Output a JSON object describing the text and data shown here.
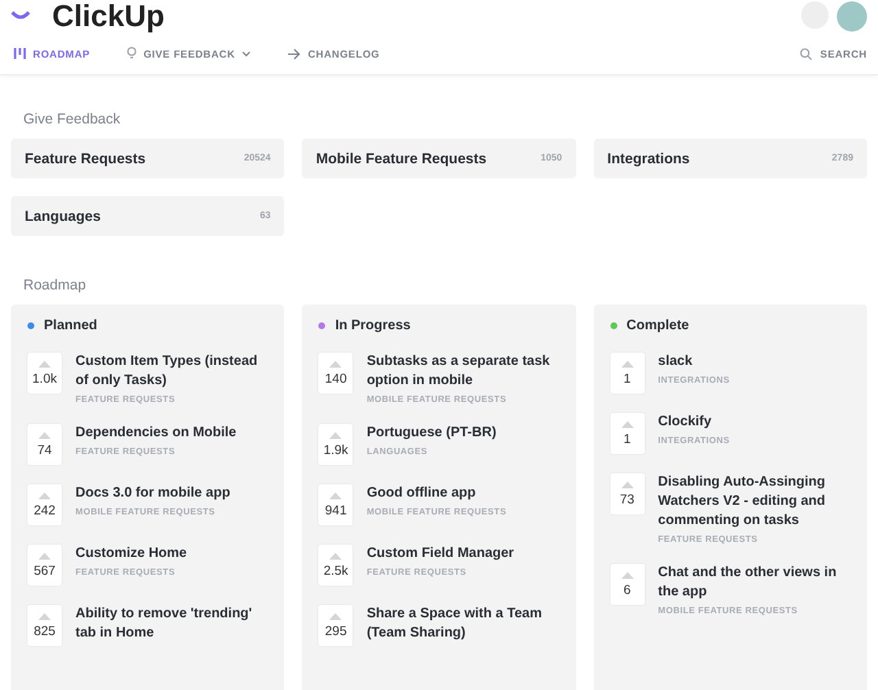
{
  "header": {
    "logo": "ClickUp"
  },
  "nav": [
    {
      "label": "ROADMAP",
      "kind": "roadmap",
      "selected": true
    },
    {
      "label": "GIVE FEEDBACK",
      "kind": "feedback",
      "selected": false,
      "dropdown": true
    },
    {
      "label": "CHANGELOG",
      "kind": "changelog",
      "selected": false
    }
  ],
  "search": {
    "label": "SEARCH"
  },
  "feedback": {
    "title": "Give Feedback",
    "boards": [
      {
        "name": "Feature Requests",
        "count": "20524"
      },
      {
        "name": "Mobile Feature Requests",
        "count": "1050"
      },
      {
        "name": "Integrations",
        "count": "2789"
      },
      {
        "name": "Languages",
        "count": "63"
      }
    ]
  },
  "roadmap": {
    "title": "Roadmap",
    "columns": [
      {
        "name": "Planned",
        "color": "#3b8ee8",
        "items": [
          {
            "votes": "1.0k",
            "title": "Custom Item Types (instead of only Tasks)",
            "category": "FEATURE REQUESTS"
          },
          {
            "votes": "74",
            "title": "Dependencies on Mobile",
            "category": "FEATURE REQUESTS"
          },
          {
            "votes": "242",
            "title": "Docs 3.0 for mobile app",
            "category": "MOBILE FEATURE REQUESTS"
          },
          {
            "votes": "567",
            "title": "Customize Home",
            "category": "FEATURE REQUESTS"
          },
          {
            "votes": "825",
            "title": "Ability to remove 'trending' tab in Home"
          }
        ]
      },
      {
        "name": "In Progress",
        "color": "#b27ae6",
        "items": [
          {
            "votes": "140",
            "title": "Subtasks as a separate task option in mobile",
            "category": "MOBILE FEATURE REQUESTS"
          },
          {
            "votes": "1.9k",
            "title": "Portuguese (PT-BR)",
            "category": "LANGUAGES"
          },
          {
            "votes": "941",
            "title": "Good offline app",
            "category": "MOBILE FEATURE REQUESTS"
          },
          {
            "votes": "2.5k",
            "title": "Custom Field Manager",
            "category": "FEATURE REQUESTS"
          },
          {
            "votes": "295",
            "title": "Share a Space with a Team (Team Sharing)"
          }
        ]
      },
      {
        "name": "Complete",
        "color": "#5cc85c",
        "items": [
          {
            "votes": "1",
            "title": "slack",
            "category": "INTEGRATIONS"
          },
          {
            "votes": "1",
            "title": "Clockify",
            "category": "INTEGRATIONS"
          },
          {
            "votes": "73",
            "title": "Disabling Auto-Assinging Watchers V2 - editing and commenting on tasks",
            "category": "FEATURE REQUESTS"
          },
          {
            "votes": "6",
            "title": "Chat and the other views in the app",
            "category": "MOBILE FEATURE REQUESTS"
          }
        ]
      }
    ]
  }
}
